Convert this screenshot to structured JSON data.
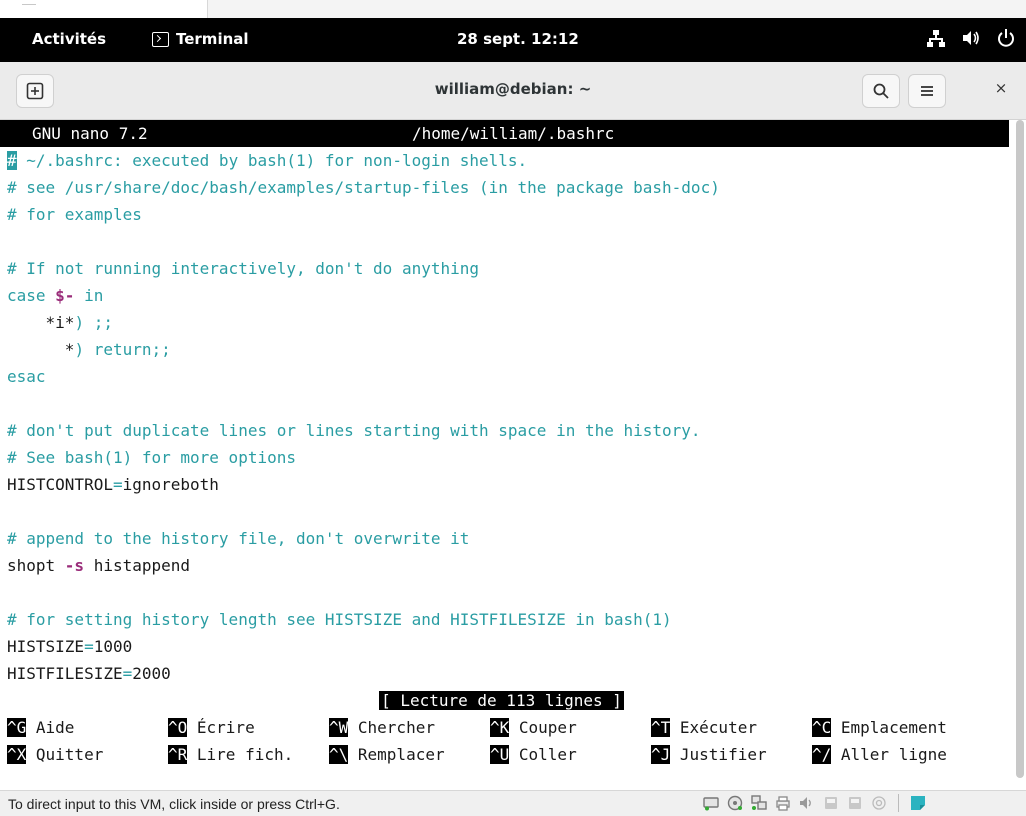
{
  "gnome": {
    "activities": "Activités",
    "app_name": "Terminal",
    "clock": "28 sept. 12:12"
  },
  "window": {
    "title": "william@debian: ~",
    "close": "×"
  },
  "nano": {
    "version": "GNU nano 7.2",
    "path": "/home/william/.bashrc",
    "cursor_char": "#",
    "lines": {
      "l1": " ~/.bashrc: executed by bash(1) for non-login shells.",
      "l2": "# see /usr/share/doc/bash/examples/startup-files (in the package bash-doc)",
      "l3": "# for examples",
      "l5": "# If not running interactively, don't do anything",
      "l6_kw": "case ",
      "l6_op": "$-",
      "l6_rest": " in",
      "l7_a": "    *i*",
      "l7_b": ") ;;",
      "l8_a": "      *",
      "l8_b": ") return;;",
      "l9": "esac",
      "l11": "# don't put duplicate lines or lines starting with space in the history.",
      "l12": "# See bash(1) for more options",
      "l13_a": "HISTCONTROL",
      "l13_b": "=",
      "l13_c": "ignoreboth",
      "l15": "# append to the history file, don't overwrite it",
      "l16_a": "shopt ",
      "l16_b": "-s",
      "l16_c": " histappend",
      "l18": "# for setting history length see HISTSIZE and HISTFILESIZE in bash(1)",
      "l19_a": "HISTSIZE",
      "l19_b": "=",
      "l19_c": "1000",
      "l20_a": "HISTFILESIZE",
      "l20_b": "=",
      "l20_c": "2000"
    },
    "status": "[ Lecture de 113 lignes ]",
    "shortcuts_row1": [
      {
        "key": "^G",
        "label": " Aide"
      },
      {
        "key": "^O",
        "label": " Écrire"
      },
      {
        "key": "^W",
        "label": " Chercher"
      },
      {
        "key": "^K",
        "label": " Couper"
      },
      {
        "key": "^T",
        "label": " Exécuter"
      },
      {
        "key": "^C",
        "label": " Emplacement"
      }
    ],
    "shortcuts_row2": [
      {
        "key": "^X",
        "label": " Quitter"
      },
      {
        "key": "^R",
        "label": " Lire fich."
      },
      {
        "key": "^\\",
        "label": " Remplacer"
      },
      {
        "key": "^U",
        "label": " Coller"
      },
      {
        "key": "^J",
        "label": " Justifier"
      },
      {
        "key": "^/",
        "label": " Aller ligne"
      }
    ]
  },
  "vm": {
    "message": "To direct input to this VM, click inside or press Ctrl+G."
  },
  "colors": {
    "comment": "#2a9da3",
    "operator": "#9a2d7a"
  }
}
